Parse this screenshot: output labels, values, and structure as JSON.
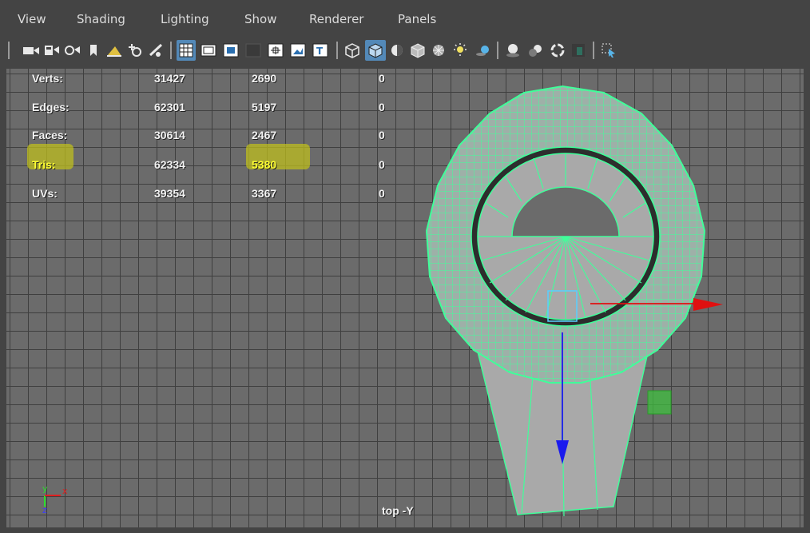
{
  "menu": [
    "View",
    "Shading",
    "Lighting",
    "Show",
    "Renderer",
    "Panels"
  ],
  "toolbar_icons": [
    "camera-icon",
    "camera-attrs-icon",
    "camera-lock-icon",
    "bookmark-icon",
    "image-plane-icon",
    "pan-icon",
    "paint-icon",
    "grid-toggle-icon",
    "film-gate-icon",
    "resolution-gate-icon",
    "gate-mask-icon",
    "field-chart-icon",
    "safe-action-icon",
    "safe-title-icon",
    "wireframe-icon",
    "smooth-shade-icon",
    "wireframe-on-shaded-icon",
    "xray-icon",
    "xray-joints-icon",
    "default-light-icon",
    "shadows-icon",
    "screen-space-ao-icon",
    "motion-blur-icon",
    "anti-alias-icon",
    "depth-of-field-icon",
    "isolate-select-icon"
  ],
  "hud": {
    "rows": [
      {
        "label": "Verts:",
        "c1": "31427",
        "c2": "2690",
        "c3": "0"
      },
      {
        "label": "Edges:",
        "c1": "62301",
        "c2": "5197",
        "c3": "0"
      },
      {
        "label": "Faces:",
        "c1": "30614",
        "c2": "2467",
        "c3": "0"
      },
      {
        "label": "Tris:",
        "c1": "62334",
        "c2": "5380",
        "c3": "0"
      },
      {
        "label": "UVs:",
        "c1": "39354",
        "c2": "3367",
        "c3": "0"
      }
    ],
    "highlight_color": "#ffff33"
  },
  "camera_label": "top -Y",
  "axis_labels": {
    "y": "y",
    "x": "x",
    "z": "z"
  },
  "colors": {
    "wire": "#40ff9a",
    "mesh": "#a8a8a8",
    "x_axis": "#e01010",
    "z_axis": "#1a1aee",
    "bg": "#6b6b6b"
  }
}
